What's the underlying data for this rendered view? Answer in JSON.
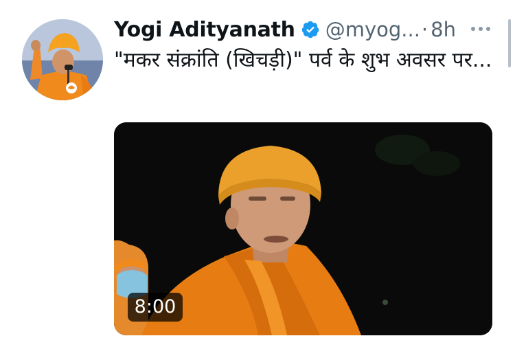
{
  "tweet": {
    "author": {
      "display_name": "Yogi Adityanath",
      "handle": "@myog...",
      "verified": true
    },
    "separator": "·",
    "timestamp": "8h",
    "text": "\"मकर संक्रांति (खिचड़ी)\" पर्व के शुभ अवसर पर...",
    "media": {
      "type": "video",
      "duration": "8:00"
    }
  },
  "icons": {
    "verified": "verified-badge-icon",
    "more": "more-options-icon"
  },
  "colors": {
    "text_primary": "#0f1419",
    "text_secondary": "#536471",
    "verified_blue": "#1d9bf0",
    "saffron": "#f28c1e"
  }
}
